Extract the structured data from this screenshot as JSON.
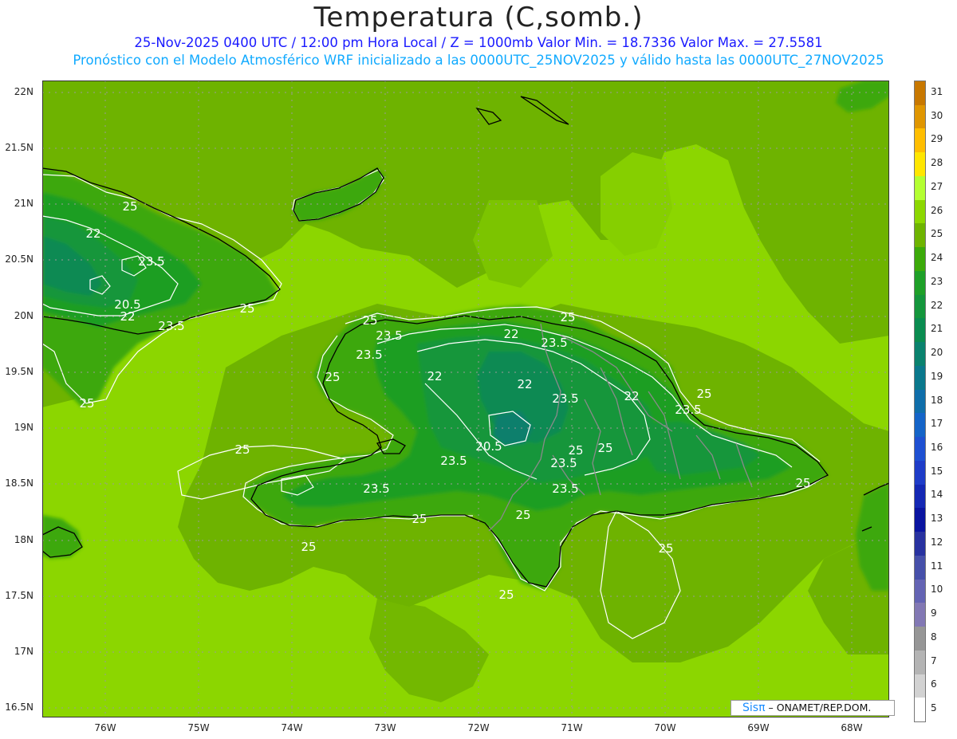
{
  "title": "Temperatura (C,somb.)",
  "subtitle_line1": "25-Nov-2025 0400 UTC / 12:00 pm Hora Local / Z = 1000mb  Valor Min. = 18.7336  Valor Max. = 27.5581",
  "subtitle_line2": "Pronóstico con el Modelo Atmosférico WRF inicializado a las 0000UTC_25NOV2025 y válido hasta las  0000UTC_27NOV2025",
  "lat_labels": [
    "22N",
    "21.5N",
    "21N",
    "20.5N",
    "20N",
    "19.5N",
    "19N",
    "18.5N",
    "18N",
    "17.5N",
    "17N",
    "16.5N"
  ],
  "lon_labels": [
    "76W",
    "75W",
    "74W",
    "73W",
    "72W",
    "71W",
    "70W",
    "69W",
    "68W"
  ],
  "colorbar_labels": [
    "31",
    "30",
    "29",
    "28",
    "27",
    "26",
    "25",
    "24",
    "23",
    "22",
    "21",
    "20",
    "19",
    "18",
    "17",
    "16",
    "15",
    "14",
    "13",
    "12",
    "11",
    "10",
    "9",
    "8",
    "7",
    "6",
    "5"
  ],
  "colorbar_colors": [
    "#c87800",
    "#e09600",
    "#ffbe00",
    "#ffe600",
    "#b4ff32",
    "#8cd700",
    "#6eb400",
    "#3caa0a",
    "#1ea028",
    "#14963c",
    "#0a8c50",
    "#0a826e",
    "#0a788c",
    "#0f6eaa",
    "#1464c8",
    "#1e50d2",
    "#1e3cc8",
    "#1428b4",
    "#0a14a0",
    "#2832a0",
    "#4650aa",
    "#6464b4",
    "#8278b4",
    "#969696",
    "#b4b4b4",
    "#d2d2d2",
    "#ffffff"
  ],
  "contour_labels": [
    "25",
    "22",
    "23.5",
    "20.5",
    "22",
    "23.5",
    "25",
    "25",
    "25",
    "23.5",
    "22",
    "23.5",
    "25",
    "22",
    "22",
    "23.5",
    "22",
    "25",
    "20.5",
    "23.5",
    "23.5",
    "25",
    "25",
    "23.5",
    "23.5",
    "25",
    "23.5",
    "25",
    "25",
    "23.5",
    "25",
    "25",
    "25",
    "25",
    "25"
  ],
  "credit": {
    "brand": "Sisπ",
    "text": " – ONAMET/REP.DOM."
  },
  "colors": {
    "sea": "#8cd600",
    "land_shade": "#6eb300",
    "temp_24": "#3ca80b",
    "temp_23": "#1e9e24",
    "temp_22": "#15963a",
    "temp_21": "#0d8a52",
    "temp_20": "#0c7f6c",
    "contour": "#ffffff",
    "coast": "#000000",
    "border": "#888888"
  }
}
